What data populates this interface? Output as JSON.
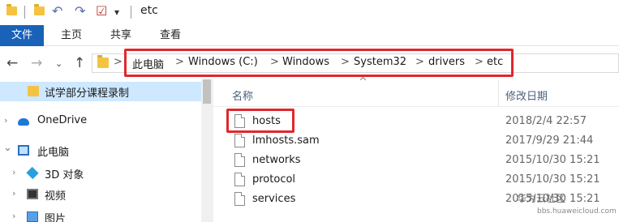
{
  "window": {
    "title": "etc"
  },
  "ribbon": {
    "tabs": [
      {
        "label": "文件"
      },
      {
        "label": "主页"
      },
      {
        "label": "共享"
      },
      {
        "label": "查看"
      }
    ]
  },
  "address": {
    "crumbs": [
      "此电脑",
      "Windows (C:)",
      "Windows",
      "System32",
      "drivers",
      "etc"
    ],
    "separator": ">"
  },
  "columns": {
    "name": "名称",
    "date": "修改日期"
  },
  "sidebar": {
    "items": [
      {
        "label": "试学部分课程录制",
        "icon": "folder-icon",
        "selected": true
      },
      {
        "label": "OneDrive",
        "icon": "onedrive-cloud-icon",
        "expand": "›"
      },
      {
        "label": "此电脑",
        "icon": "this-pc-icon",
        "expand": "⌄"
      },
      {
        "label": "3D 对象",
        "icon": "3d-objects-icon",
        "expand": "›"
      },
      {
        "label": "视频",
        "icon": "video-icon",
        "expand": "›"
      },
      {
        "label": "图片",
        "icon": "pictures-icon",
        "expand": "›"
      }
    ]
  },
  "files": [
    {
      "name": "hosts",
      "date": "2018/2/4 22:57"
    },
    {
      "name": "lmhosts.sam",
      "date": "2017/9/29 21:44"
    },
    {
      "name": "networks",
      "date": "2015/10/30 15:21"
    },
    {
      "name": "protocol",
      "date": "2015/10/30 15:21"
    },
    {
      "name": "services",
      "date": "2015/10/30 15:21"
    }
  ],
  "watermark": {
    "text": "华为云社区",
    "sub": "bbs.huaweicloud.com"
  },
  "colors": {
    "accent": "#1a62b8",
    "highlight": "#e0272d",
    "selected": "#cde8ff"
  }
}
